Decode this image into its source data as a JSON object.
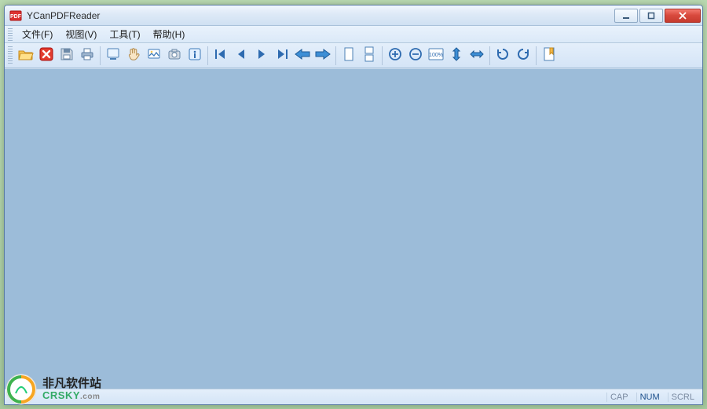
{
  "window": {
    "title": "YCanPDFReader"
  },
  "menu": {
    "file": "文件(F)",
    "view": "视图(V)",
    "tools": "工具(T)",
    "help": "帮助(H)"
  },
  "toolbar": {
    "open": "open",
    "close": "close",
    "save": "save",
    "print": "print",
    "select_tool": "select",
    "hand_tool": "hand",
    "snapshot": "snapshot",
    "camera": "camera",
    "info": "info",
    "first_page": "first",
    "prev_page": "prev",
    "next_page": "next",
    "last_page": "last",
    "back": "back",
    "forward": "forward",
    "single_page": "single",
    "continuous": "continuous",
    "zoom_in": "zoom-in",
    "zoom_out": "zoom-out",
    "actual_size": "100%",
    "fit_height": "fit-height",
    "fit_width": "fit-width",
    "rotate_left": "rotate-left",
    "rotate_right": "rotate-right",
    "bookmark": "bookmark"
  },
  "status": {
    "cap": "CAP",
    "num": "NUM",
    "scrl": "SCRL"
  },
  "watermark": {
    "cn": "非凡软件站",
    "en": "CRSKY",
    "suffix": ".com"
  }
}
